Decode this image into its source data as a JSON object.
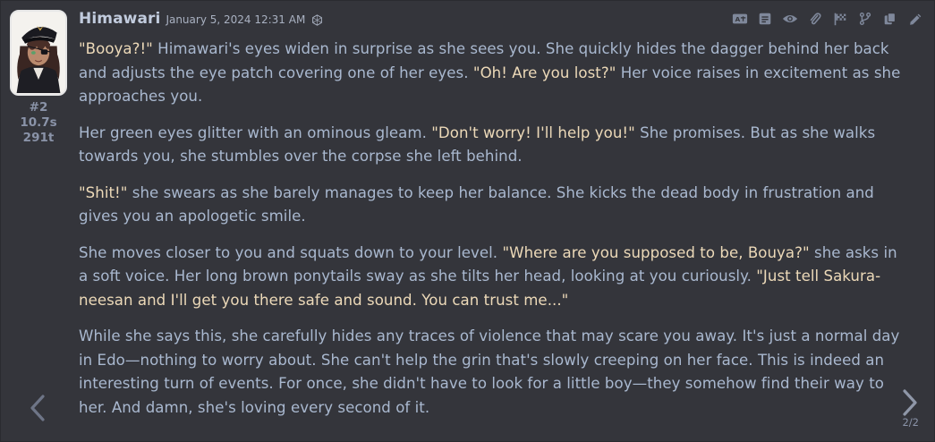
{
  "message": {
    "character_name": "Himawari",
    "timestamp": "January 5, 2024 12:31 AM",
    "model_icon": "openai-icon",
    "message_id": "#2",
    "generation_time": "10.7s",
    "token_count": "291t",
    "swipe_counter": "2/2",
    "toolbar_icons": [
      "translate-icon",
      "prompt-icon",
      "eye-icon",
      "paperclip-icon",
      "flag-icon",
      "branch-icon",
      "copy-icon",
      "edit-icon"
    ],
    "paragraphs": [
      [
        {
          "t": "\"Booya?!\"",
          "q": true
        },
        {
          "t": " Himawari's eyes widen in surprise as she sees you. She quickly hides the dagger behind her back and adjusts the eye patch covering one of her eyes. ",
          "q": false
        },
        {
          "t": "\"Oh! Are you lost?\"",
          "q": true
        },
        {
          "t": " Her voice raises in excitement as she approaches you.",
          "q": false
        }
      ],
      [
        {
          "t": "Her green eyes glitter with an ominous gleam. ",
          "q": false
        },
        {
          "t": "\"Don't worry! I'll help you!\"",
          "q": true
        },
        {
          "t": " She promises. But as she walks towards you, she stumbles over the corpse she left behind.",
          "q": false
        }
      ],
      [
        {
          "t": "\"Shit!\"",
          "q": true
        },
        {
          "t": " she swears as she barely manages to keep her balance. She kicks the dead body in frustration and gives you an apologetic smile.",
          "q": false
        }
      ],
      [
        {
          "t": "She moves closer to you and squats down to your level. ",
          "q": false
        },
        {
          "t": "\"Where are you supposed to be, Bouya?\"",
          "q": true
        },
        {
          "t": " she asks in a soft voice. Her long brown ponytails sway as she tilts her head, looking at you curiously. ",
          "q": false
        },
        {
          "t": "\"Just tell Sakura-neesan and I'll get you there safe and sound. You can trust me...\"",
          "q": true
        }
      ],
      [
        {
          "t": "While she says this, she carefully hides any traces of violence that may scare you away. It's just a normal day in Edo—nothing to worry about. She can't help the grin that's slowly creeping on her face. This is indeed an interesting turn of events. For once, she didn't have to look for a little boy—they somehow find their way to her. And damn, she's loving every second of it.",
          "q": false
        }
      ]
    ]
  },
  "colors": {
    "background": "#34353b",
    "text": "#a9b8cf",
    "quote": "#ecd9b8",
    "name": "#c1cbdd",
    "muted": "#8a93a8",
    "icon": "#7f889b"
  }
}
